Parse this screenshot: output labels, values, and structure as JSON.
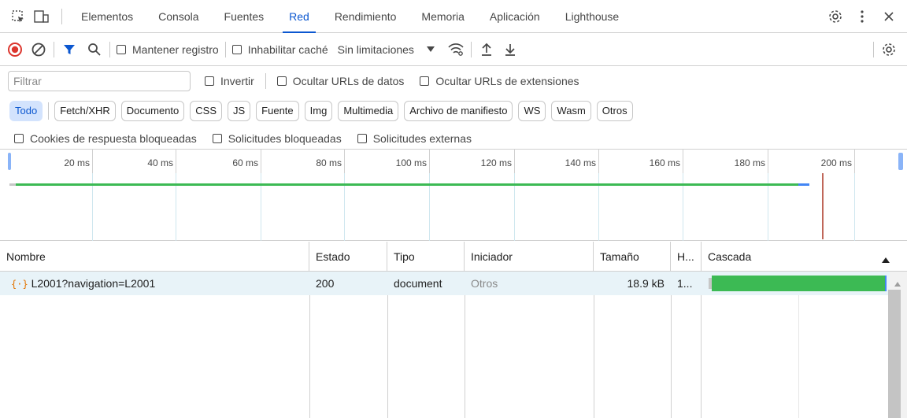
{
  "tabs": {
    "items": [
      "Elementos",
      "Consola",
      "Fuentes",
      "Red",
      "Rendimiento",
      "Memoria",
      "Aplicación",
      "Lighthouse"
    ],
    "active": "Red"
  },
  "toolbar": {
    "preserve_log": "Mantener registro",
    "disable_cache": "Inhabilitar caché",
    "throttling": "Sin limitaciones"
  },
  "filter": {
    "placeholder": "Filtrar",
    "invert": "Invertir",
    "hide_data_urls": "Ocultar URLs de datos",
    "hide_extension_urls": "Ocultar URLs de extensiones"
  },
  "types": [
    "Todo",
    "Fetch/XHR",
    "Documento",
    "CSS",
    "JS",
    "Fuente",
    "Img",
    "Multimedia",
    "Archivo de manifiesto",
    "WS",
    "Wasm",
    "Otros"
  ],
  "blocked": {
    "cookies": "Cookies de respuesta bloqueadas",
    "requests": "Solicitudes bloqueadas",
    "third_party": "Solicitudes externas"
  },
  "overview": {
    "ticks": [
      "20 ms",
      "40 ms",
      "60 ms",
      "80 ms",
      "100 ms",
      "120 ms",
      "140 ms",
      "160 ms",
      "180 ms",
      "200 ms"
    ]
  },
  "table": {
    "headers": {
      "name": "Nombre",
      "status": "Estado",
      "type": "Tipo",
      "initiator": "Iniciador",
      "size": "Tamaño",
      "time": "H...",
      "waterfall": "Cascada"
    },
    "rows": [
      {
        "name": "L2001?navigation=L2001",
        "status": "200",
        "type": "document",
        "initiator": "Otros",
        "size": "18.9 kB",
        "time": "1..."
      }
    ]
  },
  "colors": {
    "accent": "#0b57d0",
    "record": "#dc362e",
    "waterfall_bar": "#3cba54",
    "selected_row": "#e8f3f8"
  }
}
